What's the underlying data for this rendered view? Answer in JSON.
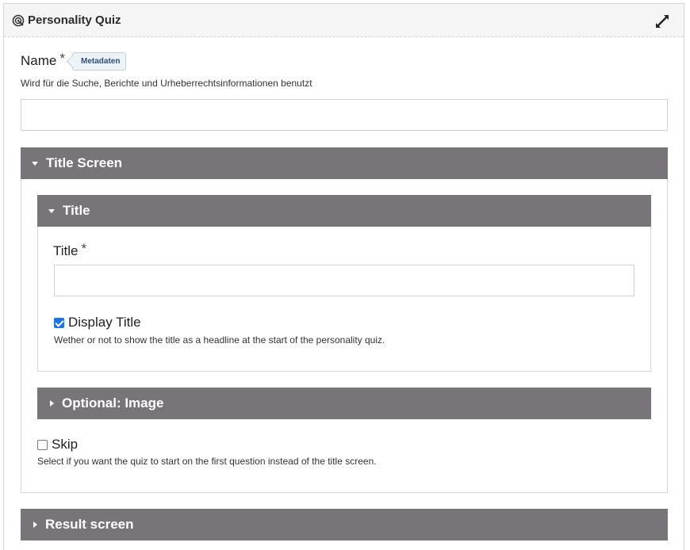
{
  "app": {
    "title": "Personality Quiz"
  },
  "name_field": {
    "label": "Name",
    "required_mark": "*",
    "metadata_label": "Metadaten",
    "description": "Wird für die Suche, Berichte und Urheberrechtsinformationen benutzt",
    "value": ""
  },
  "title_screen": {
    "header": "Title Screen",
    "title_group": {
      "header": "Title",
      "label": "Title",
      "required_mark": "*",
      "value": "",
      "display_title": {
        "label": "Display Title",
        "checked": true,
        "description": "Wether or not to show the title as a headline at the start of the personality quiz."
      }
    },
    "image_group": {
      "header": "Optional: Image"
    },
    "skip": {
      "label": "Skip",
      "checked": false,
      "description": "Select if you want the quiz to start on the first question instead of the title screen."
    }
  },
  "result_screen": {
    "header": "Result screen"
  }
}
